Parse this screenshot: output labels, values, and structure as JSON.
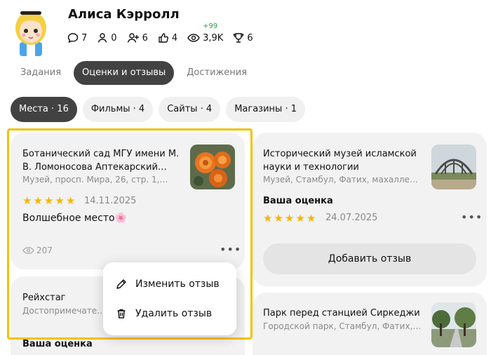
{
  "profile": {
    "name": "Алиса Кэрролл",
    "stats": [
      {
        "icon": "comment-icon",
        "value": "7"
      },
      {
        "icon": "person-icon",
        "value": "0"
      },
      {
        "icon": "follow-icon",
        "value": "6"
      },
      {
        "icon": "like-icon",
        "value": "4"
      },
      {
        "icon": "eye-icon",
        "value": "3,9K",
        "delta": "+99"
      },
      {
        "icon": "trophy-icon",
        "value": "6"
      }
    ]
  },
  "tabs": [
    {
      "label": "Задания",
      "active": false
    },
    {
      "label": "Оценки и отзывы",
      "active": true
    },
    {
      "label": "Достижения",
      "active": false
    }
  ],
  "filters": [
    {
      "label": "Места · 16",
      "active": true
    },
    {
      "label": "Фильмы · 4",
      "active": false
    },
    {
      "label": "Сайты · 4",
      "active": false
    },
    {
      "label": "Магазины · 1",
      "active": false
    }
  ],
  "cards": {
    "botanic": {
      "title": "Ботанический сад МГУ имени М. В. Ломоносова Аптекарский…",
      "subtitle": "Музей, просп. Мира, 26, стр. 1,…",
      "rating": 5,
      "date": "14.11.2025",
      "review": "Волшебное место🌸",
      "views": "207"
    },
    "museum": {
      "title": "Исторический музей исламской науки и технологии",
      "subtitle": "Музей, Стамбул, Фатих, махалле…",
      "rating_label": "Ваша оценка",
      "rating": 5,
      "date": "24.07.2025",
      "add_review": "Добавить отзыв"
    },
    "reichstag": {
      "title": "Рейхстаг",
      "subtitle": "Достопримечател…",
      "rating_label": "Ваша оценка"
    },
    "park": {
      "title": "Парк перед станцией Сиркеджи",
      "subtitle": "Городской парк, Стамбул, Фатих,…"
    }
  },
  "menu": {
    "edit": "Изменить отзыв",
    "delete": "Удалить отзыв"
  },
  "colors": {
    "accent_highlight": "#f2c200",
    "star": "#f7b500",
    "active_tab": "#424242",
    "delta_green": "#22a34a"
  }
}
